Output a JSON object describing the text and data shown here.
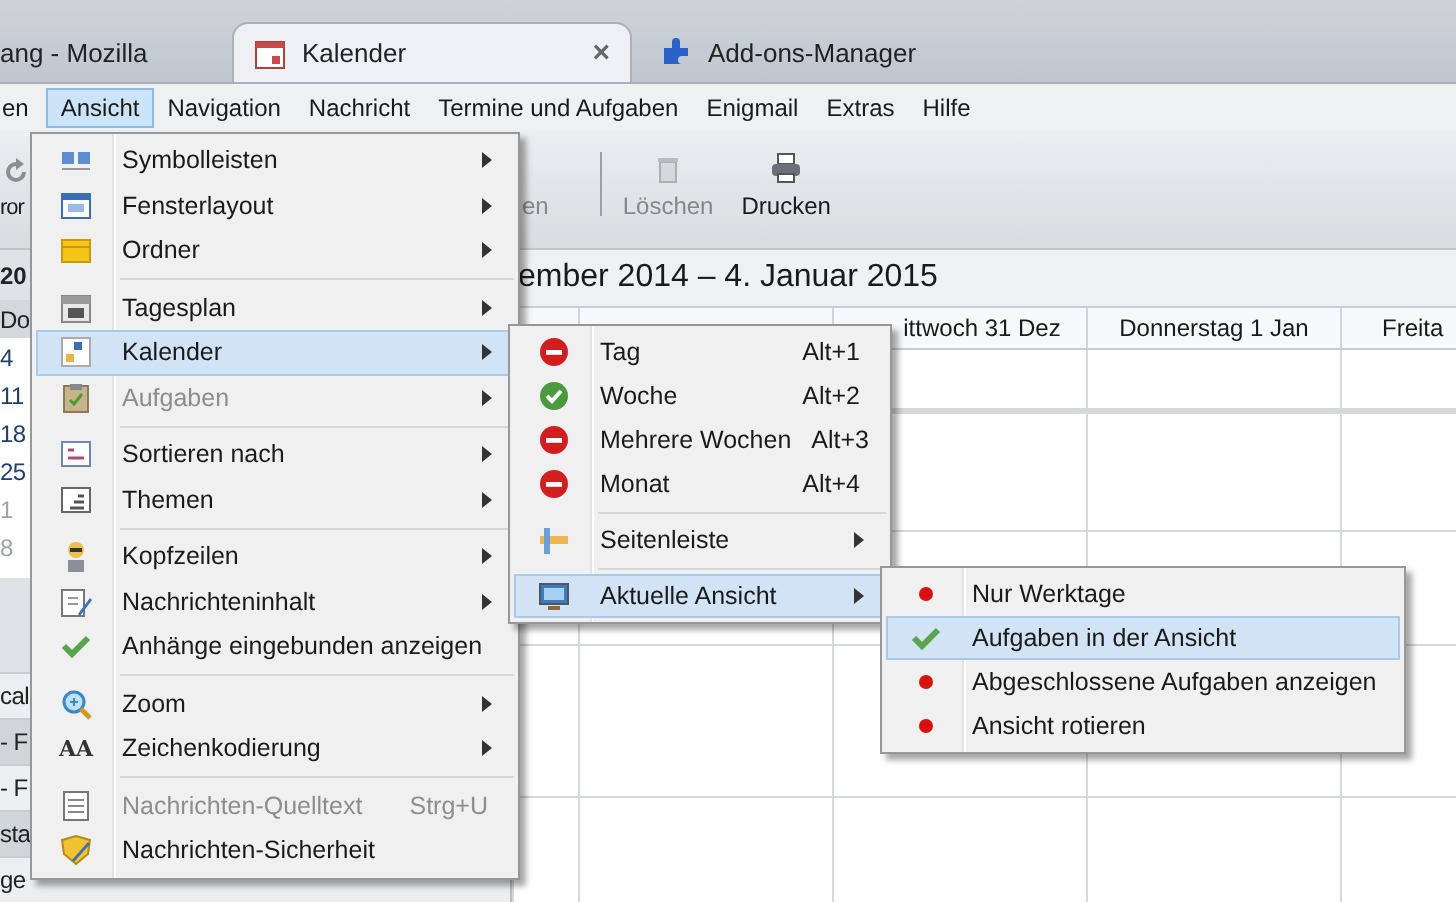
{
  "tabs": [
    {
      "label": "ang - Mozilla",
      "selected": false
    },
    {
      "label": "Kalender",
      "selected": true,
      "close": "×"
    },
    {
      "label": "Add-ons-Manager",
      "selected": false
    }
  ],
  "menubar": [
    {
      "label": "en",
      "selected": false
    },
    {
      "label": "Ansicht",
      "selected": true
    },
    {
      "label": "Navigation",
      "selected": false
    },
    {
      "label": "Nachricht",
      "selected": false
    },
    {
      "label": "Termine und Aufgaben",
      "selected": false
    },
    {
      "label": "Enigmail",
      "selected": false
    },
    {
      "label": "Extras",
      "selected": false
    },
    {
      "label": "Hilfe",
      "selected": false
    }
  ],
  "toolbar": [
    {
      "label": "ror",
      "disabled": false
    },
    {
      "label": "en",
      "disabled": true
    },
    {
      "label": "Löschen",
      "disabled": true
    },
    {
      "label": "Drucken",
      "disabled": false
    }
  ],
  "sidebar": {
    "year": "20",
    "weekday": "Do",
    "days": [
      {
        "label": "4",
        "other_month": false
      },
      {
        "label": "11",
        "other_month": false
      },
      {
        "label": "18",
        "other_month": false
      },
      {
        "label": "25",
        "other_month": false
      },
      {
        "label": "1",
        "other_month": true
      },
      {
        "label": "8",
        "other_month": true
      }
    ],
    "list": [
      "cal",
      "- F",
      "- F",
      "sta",
      "ge"
    ]
  },
  "calendar": {
    "range": "ember 2014 – 4. Januar 2015",
    "columns": [
      "ittwoch 31 Dez",
      "Donnerstag 1 Jan",
      "Freita"
    ]
  },
  "menus": [
    {
      "items": [
        {
          "kind": "submenu",
          "label": "Symbolleisten",
          "selected": false,
          "disabled": false
        },
        {
          "kind": "submenu",
          "label": "Fensterlayout",
          "selected": false,
          "disabled": false
        },
        {
          "kind": "submenu",
          "label": "Ordner",
          "selected": false,
          "disabled": false
        },
        {
          "kind": "separator"
        },
        {
          "kind": "submenu",
          "label": "Tagesplan",
          "selected": false,
          "disabled": false
        },
        {
          "kind": "submenu",
          "label": "Kalender",
          "selected": true,
          "disabled": false
        },
        {
          "kind": "submenu",
          "label": "Aufgaben",
          "selected": false,
          "disabled": true
        },
        {
          "kind": "separator"
        },
        {
          "kind": "submenu",
          "label": "Sortieren nach",
          "selected": false,
          "disabled": false
        },
        {
          "kind": "submenu",
          "label": "Themen",
          "selected": false,
          "disabled": false
        },
        {
          "kind": "separator"
        },
        {
          "kind": "submenu",
          "label": "Kopfzeilen",
          "selected": false,
          "disabled": false
        },
        {
          "kind": "submenu",
          "label": "Nachrichteninhalt",
          "selected": false,
          "disabled": false
        },
        {
          "kind": "toggle",
          "label": "Anhänge eingebunden anzeigen",
          "checked": true,
          "selected": false,
          "disabled": false
        },
        {
          "kind": "separator"
        },
        {
          "kind": "submenu",
          "label": "Zoom",
          "selected": false,
          "disabled": false
        },
        {
          "kind": "submenu",
          "label": "Zeichenkodierung",
          "glyph": "AA",
          "selected": false,
          "disabled": false
        },
        {
          "kind": "separator"
        },
        {
          "kind": "command",
          "label": "Nachrichten-Quelltext",
          "shortcut": "Strg+U",
          "selected": false,
          "disabled": true
        },
        {
          "kind": "command",
          "label": "Nachrichten-Sicherheit",
          "selected": false,
          "disabled": false
        }
      ]
    },
    {
      "items": [
        {
          "kind": "radio",
          "label": "Tag",
          "shortcut": "Alt+1",
          "checked": false,
          "selected": false,
          "disabled": false
        },
        {
          "kind": "radio",
          "label": "Woche",
          "shortcut": "Alt+2",
          "checked": true,
          "selected": false,
          "disabled": false
        },
        {
          "kind": "radio",
          "label": "Mehrere Wochen",
          "shortcut": "Alt+3",
          "checked": false,
          "selected": false,
          "disabled": false
        },
        {
          "kind": "radio",
          "label": "Monat",
          "shortcut": "Alt+4",
          "checked": false,
          "selected": false,
          "disabled": false
        },
        {
          "kind": "separator"
        },
        {
          "kind": "submenu",
          "label": "Seitenleiste",
          "selected": false,
          "disabled": false
        },
        {
          "kind": "separator"
        },
        {
          "kind": "submenu",
          "label": "Aktuelle Ansicht",
          "selected": true,
          "disabled": false
        }
      ]
    },
    {
      "items": [
        {
          "kind": "toggle",
          "label": "Nur Werktage",
          "checked": false,
          "selected": false,
          "disabled": false
        },
        {
          "kind": "toggle",
          "label": "Aufgaben in der Ansicht",
          "checked": true,
          "selected": true,
          "disabled": false
        },
        {
          "kind": "toggle",
          "label": "Abgeschlossene Aufgaben anzeigen",
          "checked": false,
          "selected": false,
          "disabled": false
        },
        {
          "kind": "toggle",
          "label": "Ansicht rotieren",
          "checked": false,
          "selected": false,
          "disabled": false
        }
      ]
    }
  ]
}
